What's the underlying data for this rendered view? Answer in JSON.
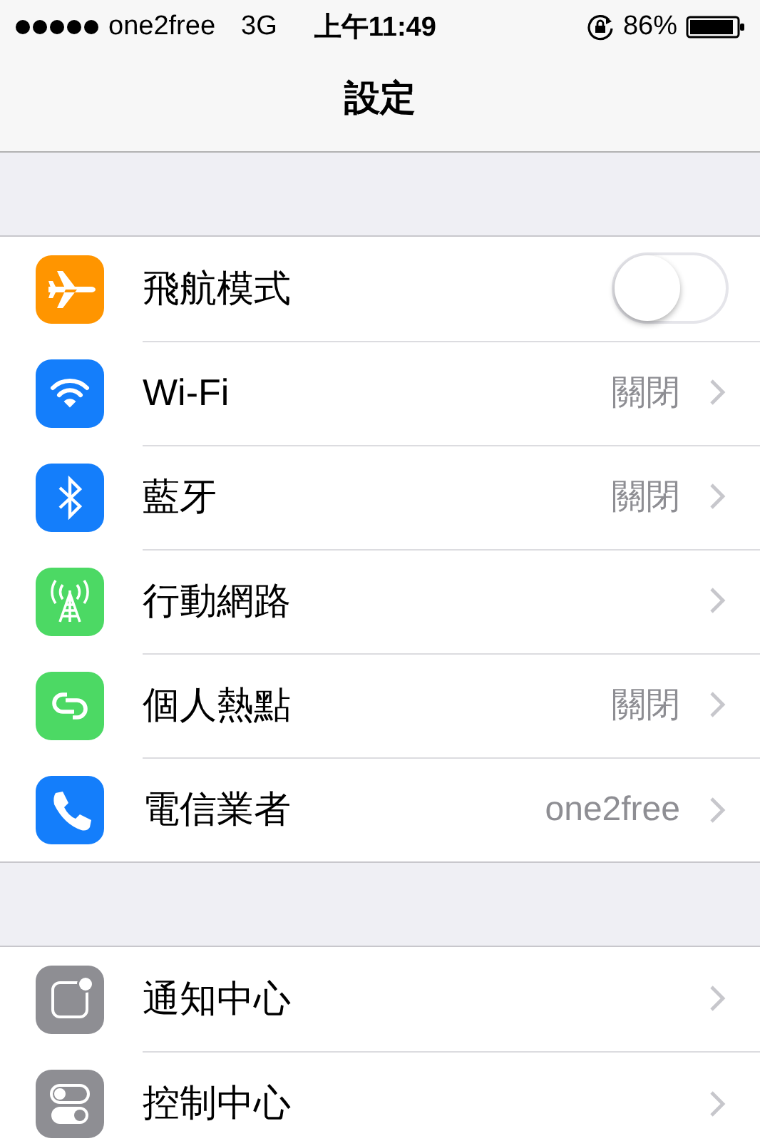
{
  "status_bar": {
    "carrier": "one2free",
    "network": "3G",
    "time": "上午11:49",
    "battery": "86%"
  },
  "nav": {
    "title": "設定"
  },
  "groups": [
    {
      "rows": [
        {
          "kind": "toggle",
          "label": "飛航模式",
          "color": "#ff9500",
          "on": false
        },
        {
          "kind": "link",
          "label": "Wi-Fi",
          "color": "#147efb",
          "value": "關閉"
        },
        {
          "kind": "link",
          "label": "藍牙",
          "color": "#147efb",
          "value": "關閉"
        },
        {
          "kind": "link",
          "label": "行動網路",
          "color": "#4cd964"
        },
        {
          "kind": "link",
          "label": "個人熱點",
          "color": "#4cd964",
          "value": "關閉"
        },
        {
          "kind": "link",
          "label": "電信業者",
          "color": "#147efb",
          "value": "one2free"
        }
      ]
    },
    {
      "rows": [
        {
          "kind": "link",
          "label": "通知中心",
          "color": "#8e8e93"
        },
        {
          "kind": "link",
          "label": "控制中心",
          "color": "#8e8e93"
        }
      ]
    }
  ]
}
